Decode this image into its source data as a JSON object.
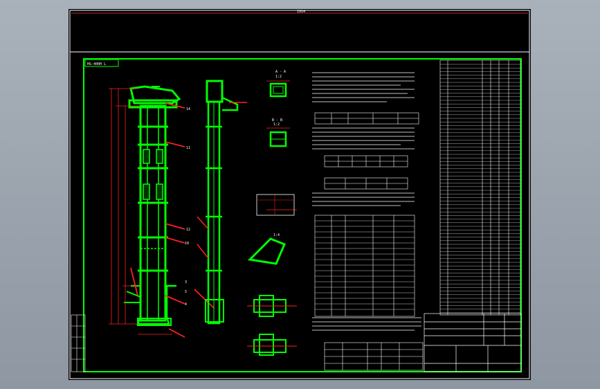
{
  "viewport": {
    "background": "#9aa3ad"
  },
  "drawing": {
    "sheet_color": "#000000",
    "border_color": "#ffffff",
    "frame_color": "#00ff00",
    "dimension_color": "#ff0000",
    "leader_color": "#ff0000",
    "text_color": "#ffffff",
    "overall_dimension": "1914",
    "corner_tag": "HS-400H L",
    "section_labels": [
      "A - A",
      "1:2",
      "B - B",
      "1:2",
      "1:4"
    ],
    "balloons": [
      "14",
      "13",
      "12",
      "11",
      "10",
      "9",
      "8",
      "7",
      "6",
      "5",
      "4",
      "3",
      "2",
      "1"
    ],
    "icon": "cad-drawing-icon"
  }
}
